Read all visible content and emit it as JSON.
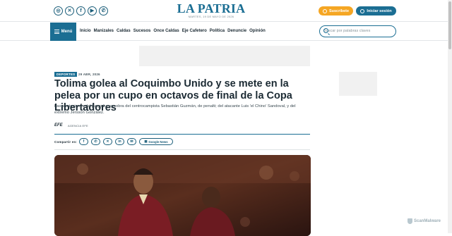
{
  "header": {
    "logo": "LA PATRIA",
    "date": "MARTES, 19 DE MAYO DE 2026",
    "socials": [
      "instagram-icon",
      "x-icon",
      "facebook-icon",
      "youtube-icon",
      "whatsapp-icon"
    ],
    "subscribe_label": "Suscríbete",
    "login_label": "Iniciar sesión"
  },
  "nav": {
    "menu_label": "Menú",
    "links": [
      "Inicio",
      "Manizales",
      "Caldas",
      "Sucesos",
      "Once Caldas",
      "Eje Cafetero",
      "Política",
      "Denuncie",
      "Opinión"
    ]
  },
  "search": {
    "placeholder": "Buscar por palabras claves"
  },
  "article": {
    "category": "DEPORTES",
    "date": "29 ABR, 2026",
    "title": "Tolima golea al Coquimbo Unido y se mete en la pelea por un cupo en octavos de final de la Copa Libertadores",
    "lead": "Las anotaciones del juego fueron obra del centrocampista Sebastián Guzmán, de penalti; del atacante Luis 'el Chino' Sandoval, y del extremo Jersson González.",
    "source_logo": "EFE",
    "agency": "AGENCIA EFE"
  },
  "share": {
    "label": "Compartir en:",
    "buttons": [
      "facebook-icon",
      "whatsapp-icon",
      "x-icon",
      "linkedin-icon",
      "email-icon"
    ],
    "google_news_label": "Google News"
  },
  "badge": "ScanMalware",
  "colors": {
    "brand": "#1b6e93",
    "accent": "#f5a623"
  }
}
